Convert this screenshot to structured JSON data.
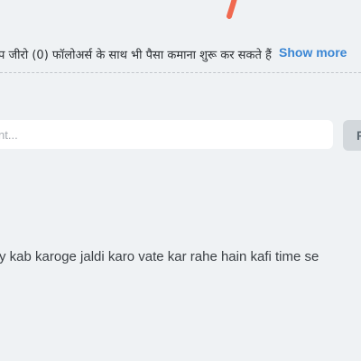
{
  "profile": {
    "description_text": "प जीरो (0) फॉलोअर्स के साथ भी पैसा कमाना शुरू कर सकते हैं",
    "show_more_label": "Show more"
  },
  "comment_box": {
    "placeholder": "nt...",
    "post_label": "P"
  },
  "comments": [
    {
      "text": "y kab karoge jaldi karo vate kar rahe hain kafi time se"
    }
  ],
  "colors": {
    "background": "#eff2f4",
    "link": "#3a86d4",
    "accent_stroke": "#f0694f",
    "button_bg": "#d3d8dc"
  }
}
